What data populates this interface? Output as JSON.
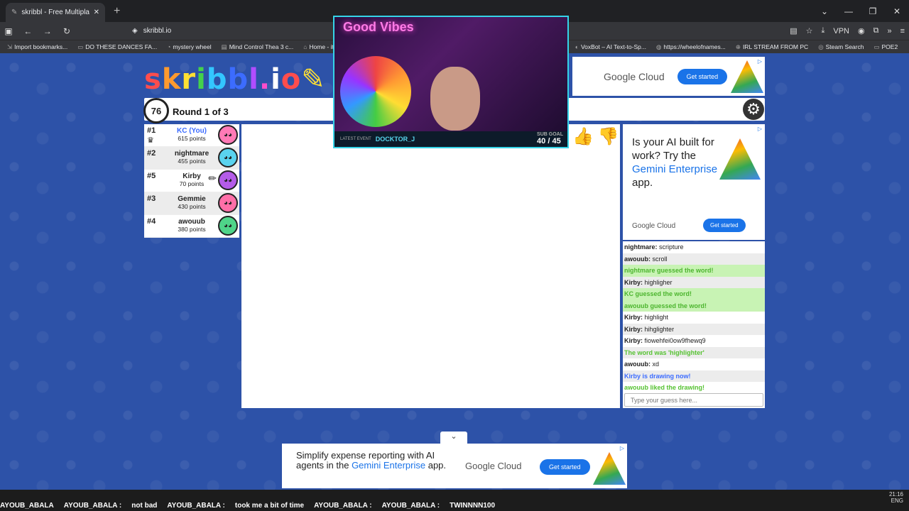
{
  "browser": {
    "tab_title": "skribbl - Free Multiplayer D",
    "url": "skribbl.io",
    "vpn_label": "VPN",
    "bookmarks": [
      "Import bookmarks...",
      "DO THESE DANCES FA...",
      "mystery wheel",
      "Mind Control Thea 3 c...",
      "Home - itskcGG",
      "VoxBot – AI Text-to-Sp...",
      "https://wheelofnames...",
      "IRL STREAM FROM PC",
      "Steam Search",
      "POE2"
    ]
  },
  "game": {
    "logo_letters": [
      "s",
      "k",
      "r",
      "i",
      "b",
      "b",
      "l",
      ".",
      "i",
      "o",
      "✎"
    ],
    "timer": "76",
    "round": "Round 1 of 3",
    "players": [
      {
        "rank": "#1",
        "name": "KC (You)",
        "points": "615 points",
        "you": true,
        "crown": true,
        "avatar_color": "#ff7ab6"
      },
      {
        "rank": "#2",
        "name": "nightmare",
        "points": "455 points",
        "avatar_color": "#5ad3ef"
      },
      {
        "rank": "#5",
        "name": "Kirby",
        "points": "70 points",
        "drawing": true,
        "avatar_color": "#b45ce8"
      },
      {
        "rank": "#3",
        "name": "Gemmie",
        "points": "430 points",
        "avatar_color": "#ff6fa8"
      },
      {
        "rank": "#4",
        "name": "awouub",
        "points": "380 points",
        "avatar_color": "#4fd489"
      }
    ],
    "chat": [
      {
        "who": "nightmare:",
        "text": "scripture",
        "kind": "normal"
      },
      {
        "who": "awouub:",
        "text": "scroll",
        "kind": "normal"
      },
      {
        "who": "",
        "text": "nightmare guessed the word!",
        "kind": "green"
      },
      {
        "who": "Kirby:",
        "text": "highligher",
        "kind": "normal"
      },
      {
        "who": "",
        "text": "KC guessed the word!",
        "kind": "green"
      },
      {
        "who": "",
        "text": "awouub guessed the word!",
        "kind": "green"
      },
      {
        "who": "Kirby:",
        "text": "highlight",
        "kind": "normal"
      },
      {
        "who": "Kirby:",
        "text": "hihglighter",
        "kind": "normal"
      },
      {
        "who": "Kirby:",
        "text": "fiowehfei0ow9fhewq9",
        "kind": "normal"
      },
      {
        "who": "",
        "text": "The word was 'highlighter'",
        "kind": "green2"
      },
      {
        "who": "awouub:",
        "text": "xd",
        "kind": "normal"
      },
      {
        "who": "",
        "text": "Kirby is drawing now!",
        "kind": "blue"
      },
      {
        "who": "",
        "text": "awouub liked the drawing!",
        "kind": "green2"
      }
    ],
    "chat_placeholder": "Type your guess here..."
  },
  "ads": {
    "brand": "Google Cloud",
    "cta": "Get started",
    "right_heading_a": "Is your AI built for work? Try the ",
    "right_heading_b": "Gemini Enterprise",
    "right_heading_c": " app.",
    "bottom_heading_a": "Simplify expense reporting with AI agents in the ",
    "bottom_heading_b": "Gemini Enterprise",
    "bottom_heading_c": " app."
  },
  "stream": {
    "sign": "Good Vibes",
    "latest_label": "LATEST EVENT",
    "latest_name": "DOCKTOR_J",
    "goal_label": "SUB GOAL",
    "goal": "40 / 45",
    "ticker": [
      "AYOUB_ABALA",
      "AYOUB_ABALA :",
      "not bad",
      "AYOUB_ABALA :",
      "took me a bit of time",
      "AYOUB_ABALA :",
      "AYOUB_ABALA :",
      "TWINNNN100"
    ],
    "time": "21:16",
    "lang": "ENG"
  }
}
